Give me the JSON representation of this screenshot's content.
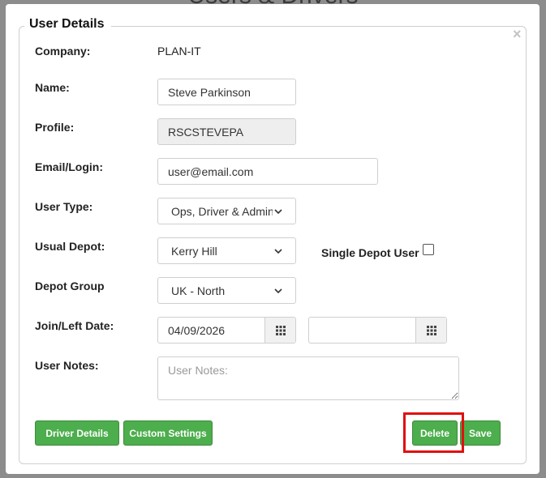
{
  "background": {
    "title": "Users & Drivers"
  },
  "modal": {
    "legend": "User Details",
    "close_glyph": "×",
    "fields": {
      "company_label": "Company:",
      "company_value": "PLAN-IT",
      "name_label": "Name:",
      "name_value": "Steve Parkinson",
      "profile_label": "Profile:",
      "profile_value": "RSCSTEVEPA",
      "email_label": "Email/Login:",
      "email_value": "user@email.com",
      "user_type_label": "User Type:",
      "user_type_value": "Ops, Driver & Admin",
      "usual_depot_label": "Usual Depot:",
      "usual_depot_value": "Kerry Hill",
      "single_depot_label": "Single Depot User",
      "single_depot_checked": false,
      "depot_group_label": "Depot Group",
      "depot_group_value": "UK - North",
      "join_left_label": "Join/Left Date:",
      "join_date": "04/09/2026",
      "left_date": "",
      "notes_label": "User Notes:",
      "notes_placeholder": "User Notes:"
    },
    "buttons": {
      "driver_details": "Driver Details",
      "custom_settings": "Custom Settings",
      "delete": "Delete",
      "save": "Save"
    }
  },
  "colors": {
    "button_green": "#4cae4c",
    "highlight_red": "#e01010",
    "overlay": "#8c8c8c"
  }
}
